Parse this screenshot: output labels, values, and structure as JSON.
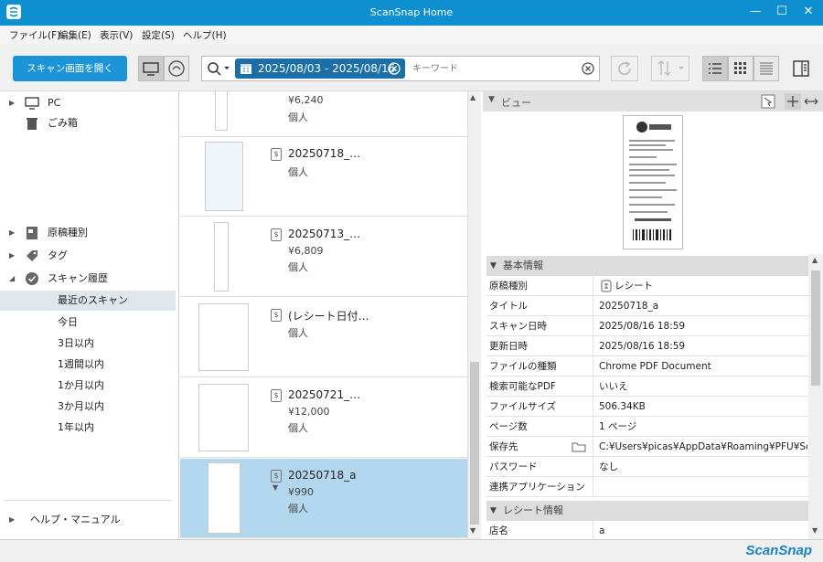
{
  "window": {
    "title": "ScanSnap Home",
    "min": "—",
    "max": "☐",
    "close": "✕"
  },
  "menu": [
    "ファイル(F)",
    "編集(E)",
    "表示(V)",
    "設定(S)",
    "ヘルプ(H)"
  ],
  "toolbar": {
    "scan_button": "スキャン画面を開く",
    "date_range": "2025/08/03 - 2025/08/16",
    "keyword_placeholder": "キーワード"
  },
  "sidebar": {
    "top": [
      {
        "label": "PC"
      },
      {
        "label": "ごみ箱"
      }
    ],
    "groups": [
      {
        "label": "原稿種別"
      },
      {
        "label": "タグ"
      },
      {
        "label": "スキャン履歴"
      }
    ],
    "history": [
      "最近のスキャン",
      "今日",
      "3日以内",
      "1週間以内",
      "1か月以内",
      "3か月以内",
      "1年以内"
    ],
    "help": "ヘルプ・マニュアル"
  },
  "records": [
    {
      "title": "",
      "amount": "¥6,240",
      "owner": "個人"
    },
    {
      "title": "20250718_…",
      "amount": "",
      "owner": "個人"
    },
    {
      "title": "20250713_…",
      "amount": "¥6,809",
      "owner": "個人"
    },
    {
      "title": "(レシート日付…",
      "amount": "",
      "owner": "個人"
    },
    {
      "title": "20250721_…",
      "amount": "¥12,000",
      "owner": "個人"
    },
    {
      "title": "20250718_a",
      "amount": "¥990",
      "owner": "個人"
    }
  ],
  "viewer": {
    "header": "ビュー"
  },
  "basic": {
    "header": "基本情報",
    "rows": [
      {
        "k": "原稿種別",
        "v": "レシート"
      },
      {
        "k": "タイトル",
        "v": "20250718_a"
      },
      {
        "k": "スキャン日時",
        "v": "2025/08/16 18:59"
      },
      {
        "k": "更新日時",
        "v": "2025/08/16 18:59"
      },
      {
        "k": "ファイルの種類",
        "v": "Chrome PDF Document"
      },
      {
        "k": "検索可能なPDF",
        "v": "いいえ"
      },
      {
        "k": "ファイルサイズ",
        "v": "506.34KB"
      },
      {
        "k": "ページ数",
        "v": "1 ページ"
      },
      {
        "k": "保存先",
        "v": "C:¥Users¥picas¥AppData¥Roaming¥PFU¥ScanS…"
      },
      {
        "k": "パスワード",
        "v": "なし"
      },
      {
        "k": "連携アプリケーション",
        "v": ""
      }
    ]
  },
  "receipt": {
    "header": "レシート情報",
    "rows": [
      {
        "k": "店名",
        "v": "a"
      }
    ]
  },
  "brand": "ScanSnap",
  "colors": {
    "accent": "#0e8fd0",
    "selected": "#b3d7ee"
  }
}
